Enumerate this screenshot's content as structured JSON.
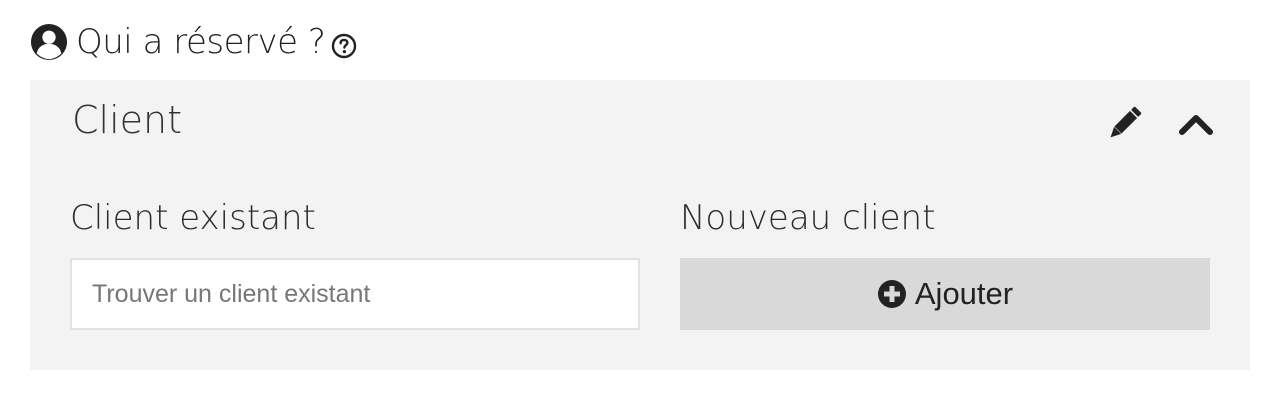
{
  "section": {
    "title": "Qui a réservé ?",
    "icon": "user-circle-icon",
    "help_icon": "question-circle-icon"
  },
  "panel": {
    "title": "Client",
    "tools": [
      "pencil-icon",
      "chevron-up-icon"
    ]
  },
  "existing_client": {
    "label": "Client existant",
    "search_placeholder": "Trouver un client existant",
    "search_value": ""
  },
  "new_client": {
    "label": "Nouveau client",
    "add_button_label": "Ajouter",
    "add_icon": "plus-circle-icon"
  },
  "colors": {
    "panel_background": "#f3f3f3",
    "button_background": "#d9d9d9",
    "icon_color": "#222222"
  }
}
